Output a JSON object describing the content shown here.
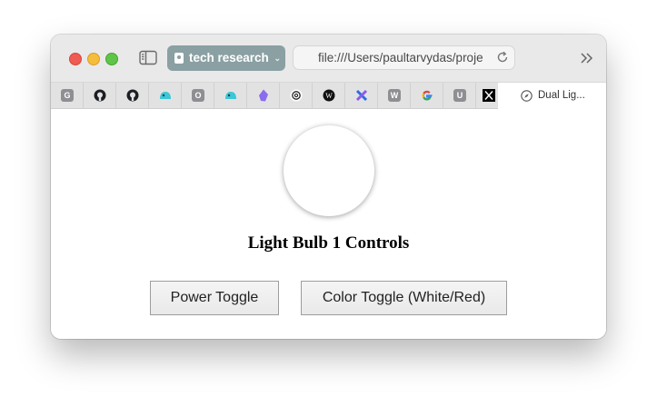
{
  "browser": {
    "tab_group_label": "tech research",
    "address_url": "file:///Users/paultarvydas/proje",
    "active_tab_title": "Dual Lig...",
    "favorites": [
      {
        "icon": "g-letter-icon",
        "letter": "G"
      },
      {
        "icon": "github-icon"
      },
      {
        "icon": "github-icon"
      },
      {
        "icon": "cyan-blob-icon"
      },
      {
        "icon": "o-letter-icon",
        "letter": "O"
      },
      {
        "icon": "cyan-blob-icon"
      },
      {
        "icon": "obsidian-icon"
      },
      {
        "icon": "openai-icon"
      },
      {
        "icon": "wikipedia-icon"
      },
      {
        "icon": "blue-x-icon"
      },
      {
        "icon": "w-letter-icon",
        "letter": "W"
      },
      {
        "icon": "google-icon"
      },
      {
        "icon": "u-letter-icon",
        "letter": "U"
      },
      {
        "icon": "x-logo-icon"
      }
    ]
  },
  "page": {
    "heading": "Light Bulb 1 Controls",
    "bulb_color": "#ffffff",
    "power_button_label": "Power Toggle",
    "color_button_label": "Color Toggle (White/Red)"
  }
}
